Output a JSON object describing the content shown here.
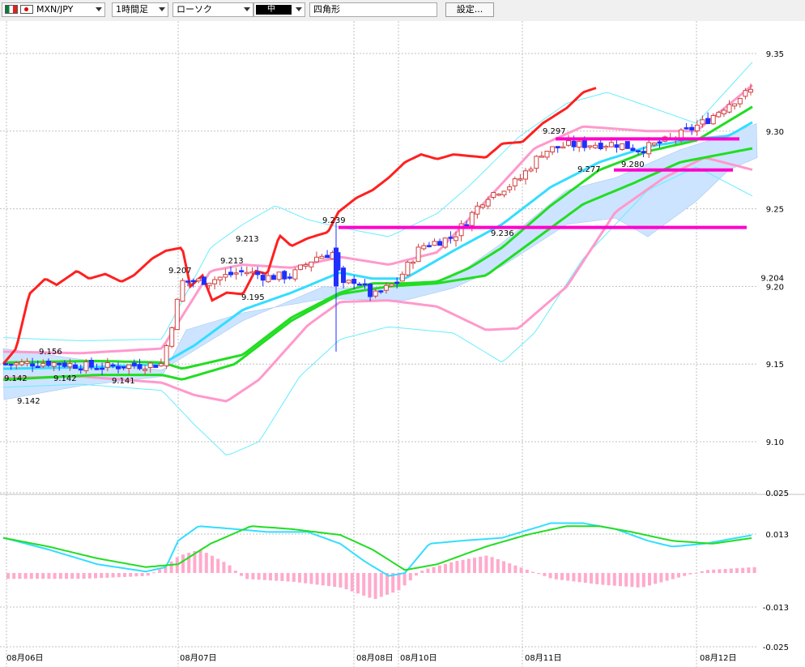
{
  "toolbar": {
    "symbol": "MXN/JPY",
    "interval": "1時間足",
    "chart_type": "ローソク",
    "color_label": "中",
    "shape": "四角形",
    "settings": "設定..."
  },
  "colors": {
    "background": "#ffffff",
    "grid": "#c0c0c0",
    "candle_up": "#e06060",
    "candle_down": "#1f2fff",
    "price_line": "#ff2020",
    "ma_short": "#33ddff",
    "ma_long": "#22dd22",
    "bb1": "#ff99cc",
    "bb2": "#66eeff",
    "cloud": "#cce4ff",
    "hline": "#ff00cc",
    "macd_hist": "#ffaacc"
  },
  "chart_data": {
    "type": "candlestick",
    "y_axis": {
      "ticks": [
        "9.35",
        "9.30",
        "9.25",
        "9.204",
        "9.20",
        "9.15",
        "9.10"
      ],
      "range": [
        9.07,
        9.373
      ]
    },
    "x_axis": {
      "labels": [
        "08月06日",
        "08月07日",
        "08月08日",
        "08月10日",
        "08月11日",
        "08月12日"
      ]
    },
    "candles_count": 140,
    "price_labels": [
      {
        "text": "9.156",
        "value": 9.156
      },
      {
        "text": "9.142",
        "value": 9.142
      },
      {
        "text": "9.142",
        "value": 9.142
      },
      {
        "text": "9.141",
        "value": 9.141
      },
      {
        "text": "9.142",
        "value": 9.142
      },
      {
        "text": "9.207",
        "value": 9.207
      },
      {
        "text": "9.213",
        "value": 9.213
      },
      {
        "text": "9.213",
        "value": 9.213
      },
      {
        "text": "9.195",
        "value": 9.195
      },
      {
        "text": "9.239",
        "value": 9.239
      },
      {
        "text": "9.236",
        "value": 9.236
      },
      {
        "text": "9.297",
        "value": 9.297
      },
      {
        "text": "9.277",
        "value": 9.277
      },
      {
        "text": "9.280",
        "value": 9.28
      }
    ],
    "horizontal_lines": [
      9.238,
      9.295,
      9.275
    ],
    "series": [
      {
        "role": "lagging-line"
      },
      {
        "role": "moving-average-short"
      },
      {
        "role": "moving-average-long"
      },
      {
        "role": "bollinger-1sigma"
      },
      {
        "role": "bollinger-2sigma"
      },
      {
        "role": "ichimoku-cloud"
      }
    ],
    "macd": {
      "ticks": [
        "0.025",
        "0.013",
        "-0.013",
        "-0.025"
      ],
      "range": [
        -0.025,
        0.025
      ],
      "current_label": "0.013"
    }
  }
}
